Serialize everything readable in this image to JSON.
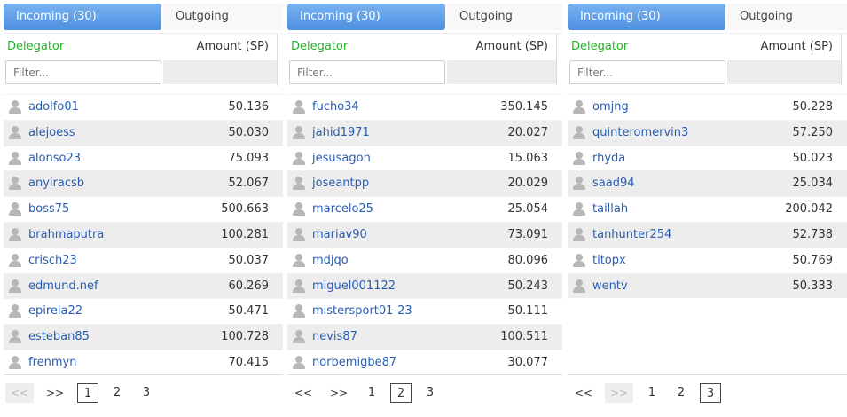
{
  "panels": [
    {
      "tabs": {
        "incoming": "Incoming (30)",
        "outgoing": "Outgoing"
      },
      "columns": {
        "delegator": "Delegator",
        "amount": "Amount (SP)"
      },
      "filter": {
        "placeholder": "Filter..."
      },
      "rows": [
        {
          "name": "adolfo01",
          "amount": "50.136"
        },
        {
          "name": "alejoess",
          "amount": "50.030"
        },
        {
          "name": "alonso23",
          "amount": "75.093"
        },
        {
          "name": "anyiracsb",
          "amount": "52.067"
        },
        {
          "name": "boss75",
          "amount": "500.663"
        },
        {
          "name": "brahmaputra",
          "amount": "100.281"
        },
        {
          "name": "crisch23",
          "amount": "50.037"
        },
        {
          "name": "edmund.nef",
          "amount": "60.269"
        },
        {
          "name": "epirela22",
          "amount": "50.471"
        },
        {
          "name": "esteban85",
          "amount": "100.728"
        },
        {
          "name": "frenmyn",
          "amount": "70.415"
        }
      ],
      "pager": {
        "prev": "<<",
        "next": ">>",
        "pages": [
          "1",
          "2",
          "3"
        ],
        "current": 1,
        "prev_disabled": true,
        "next_disabled": false
      }
    },
    {
      "tabs": {
        "incoming": "Incoming (30)",
        "outgoing": "Outgoing"
      },
      "columns": {
        "delegator": "Delegator",
        "amount": "Amount (SP)"
      },
      "filter": {
        "placeholder": "Filter..."
      },
      "rows": [
        {
          "name": "fucho34",
          "amount": "350.145"
        },
        {
          "name": "jahid1971",
          "amount": "20.027"
        },
        {
          "name": "jesusagon",
          "amount": "15.063"
        },
        {
          "name": "joseantpp",
          "amount": "20.029"
        },
        {
          "name": "marcelo25",
          "amount": "25.054"
        },
        {
          "name": "mariav90",
          "amount": "73.091"
        },
        {
          "name": "mdjqo",
          "amount": "80.096"
        },
        {
          "name": "miguel001122",
          "amount": "50.243"
        },
        {
          "name": "mistersport01-23",
          "amount": "50.111"
        },
        {
          "name": "nevis87",
          "amount": "100.511"
        },
        {
          "name": "norbemigbe87",
          "amount": "30.077"
        }
      ],
      "pager": {
        "prev": "<<",
        "next": ">>",
        "pages": [
          "1",
          "2",
          "3"
        ],
        "current": 2,
        "prev_disabled": false,
        "next_disabled": false
      }
    },
    {
      "tabs": {
        "incoming": "Incoming (30)",
        "outgoing": "Outgoing"
      },
      "columns": {
        "delegator": "Delegator",
        "amount": "Amount (SP)"
      },
      "filter": {
        "placeholder": "Filter..."
      },
      "rows": [
        {
          "name": "omjng",
          "amount": "50.228"
        },
        {
          "name": "quinteromervin3",
          "amount": "57.250"
        },
        {
          "name": "rhyda",
          "amount": "50.023"
        },
        {
          "name": "saad94",
          "amount": "25.034"
        },
        {
          "name": "taillah",
          "amount": "200.042"
        },
        {
          "name": "tanhunter254",
          "amount": "52.738"
        },
        {
          "name": "titopx",
          "amount": "50.769"
        },
        {
          "name": "wentv",
          "amount": "50.333"
        }
      ],
      "pager": {
        "prev": "<<",
        "next": ">>",
        "pages": [
          "1",
          "2",
          "3"
        ],
        "current": 3,
        "prev_disabled": false,
        "next_disabled": true
      }
    }
  ],
  "icons": {
    "row_icon": "user-icon"
  },
  "colors": {
    "active_tab": "#4d8fdf",
    "delegator_header": "#22b324",
    "link": "#2a5db0"
  }
}
